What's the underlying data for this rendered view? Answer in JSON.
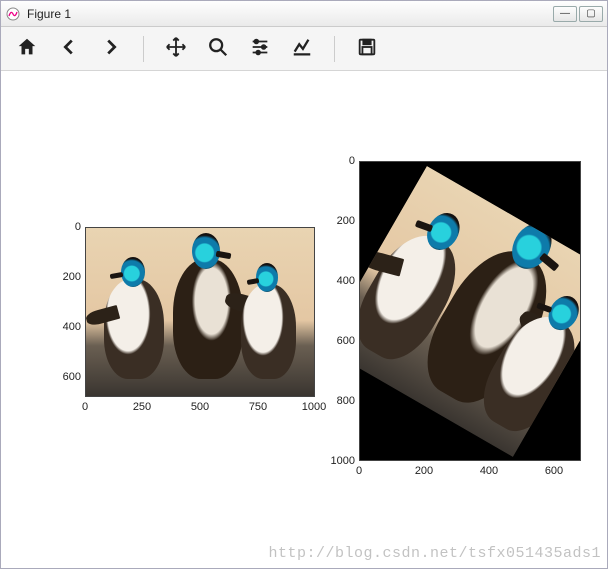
{
  "window": {
    "title": "Figure 1",
    "buttons": {
      "min": "—",
      "max": "▢",
      "close": "✕"
    }
  },
  "toolbar": {
    "home": "home-icon",
    "back": "arrow-left-icon",
    "forward": "arrow-right-icon",
    "pan": "move-icon",
    "zoom": "search-icon",
    "configure": "sliders-icon",
    "edit": "chart-line-icon",
    "save": "save-icon"
  },
  "subplots": {
    "left": {
      "x_ticks": [
        "0",
        "250",
        "500",
        "750",
        "1000"
      ],
      "y_ticks": [
        "0",
        "200",
        "400",
        "600"
      ]
    },
    "right": {
      "x_ticks": [
        "0",
        "200",
        "400",
        "600"
      ],
      "y_ticks": [
        "0",
        "200",
        "400",
        "600",
        "800",
        "1000"
      ]
    }
  },
  "watermark": "http://blog.csdn.net/tsfx051435ads1"
}
